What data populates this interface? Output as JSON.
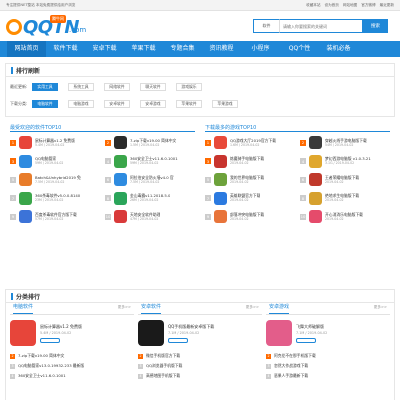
{
  "topbar": {
    "left": "专注提供NET整站 本站免费提供给用户浏览",
    "links": [
      "收藏本站",
      "设为首页",
      "网站地图",
      "官方微博",
      "最近更新"
    ]
  },
  "logo": {
    "main": "QQTN",
    "suffix": ".com",
    "badge": "腾牛网"
  },
  "search": {
    "select": "软件",
    "placeholder": "请输入你要搜索的关键词",
    "button": "搜索"
  },
  "nav": [
    "网站首页",
    "软件下载",
    "安卓下载",
    "苹果下载",
    "专题合集",
    "资讯教程",
    "小程序",
    "QQ个性",
    "装机必备"
  ],
  "ranking": {
    "title": "排行刷新",
    "filters": [
      {
        "label": "最近更新:",
        "chips": [
          "实用工具",
          "系统工具",
          "网络软件",
          "聊天软件",
          "游戏娱乐"
        ]
      },
      {
        "label": "下载分类:",
        "chips": [
          "电脑软件",
          "电脑游戏",
          "安卓软件",
          "安卓游戏",
          "苹果软件",
          "苹果游戏"
        ]
      }
    ]
  },
  "soft_panel": {
    "title": "最受欢迎的软件TOP10",
    "items": [
      {
        "name": "鼠标计算器v1.2 免费版",
        "meta": "5.4M / 2019-04-02",
        "color": "#e7453a"
      },
      {
        "name": "7-zip下载v19.00 简体中文",
        "meta": "1.5M / 2019-04-02",
        "color": "#2b2b2b"
      },
      {
        "name": "QQ电脑管家",
        "meta": "59M / 2019-04-02",
        "color": "#2e8be0"
      },
      {
        "name": "360安全卫士v11.6.0.1001",
        "meta": "59M / 2019-04-02",
        "color": "#3aa64a"
      },
      {
        "name": "Batch&Unhybrid2019 免",
        "meta": "7.5M / 2019-04-02",
        "color": "#e87c2a"
      },
      {
        "name": "阿拉伯安全防火墙v4.0 官",
        "meta": "7.5M / 2019-04-02",
        "color": "#2e8be0"
      },
      {
        "name": "360杀毒软件v5.0.0.8140",
        "meta": "23M / 2019-04-02",
        "color": "#3aa64a"
      },
      {
        "name": "金山毒霸v11.2018.5.0 ",
        "meta": "26M / 2019-04-02",
        "color": "#2aa55a"
      },
      {
        "name": "百度杀毒软件官方版下载",
        "meta": "57M / 2019-04-02",
        "color": "#3c73d8"
      },
      {
        "name": "天地安全软件助理",
        "meta": "47M / 2019-04-02",
        "color": "#d93a3a"
      }
    ]
  },
  "game_panel": {
    "title": "下载最多的游戏TOP10",
    "items": [
      {
        "name": "QQ游戏大厅2019官方下载",
        "meta": "1.6M / 2019-04-02",
        "color": "#e84a3a"
      },
      {
        "name": "穿越火线手游电脑版下载",
        "meta": "54M / 2019-04-02",
        "color": "#3a3a3a"
      },
      {
        "name": "炼魔骑手电脑版下载",
        "meta": "2019-04-02",
        "color": "#c8342e"
      },
      {
        "name": "梦幻西游电脑版 v1.0.3.21",
        "meta": "3.1G / 2019-04-02",
        "color": "#e0a72d"
      },
      {
        "name": "我的世界电脑版下载",
        "meta": "2019-04-02",
        "color": "#6da23b"
      },
      {
        "name": "王者荣耀电脑版下载",
        "meta": "2019-04-02",
        "color": "#c0392b"
      },
      {
        "name": "英雄联盟官方下载",
        "meta": "2019-04-02",
        "color": "#2b7ae0"
      },
      {
        "name": "绝地求生电脑版下载",
        "meta": "2019-04-02",
        "color": "#d6a12f"
      },
      {
        "name": "部落冲突电脑版下载",
        "meta": "2019-04-02",
        "color": "#e8743a"
      },
      {
        "name": "开心消消乐电脑版下载",
        "meta": "2019-04-02",
        "color": "#e54b6b"
      }
    ]
  },
  "category": {
    "title": "分类排行",
    "more": "更多>>",
    "columns": [
      {
        "title": "电脑软件",
        "feat": {
          "name": "鼠标计算器v1.2 免费版",
          "meta": "5.4M / 2019-04-02",
          "color": "#e7453a"
        },
        "list": [
          "7-zip下载v19.00 简体中文",
          "QQ电脑管家v13.0.19932.233 最新版",
          "360安全卫士v11.6.0.1001"
        ]
      },
      {
        "title": "安卓软件",
        "feat": {
          "name": "QQ手机版最新安卓版下载",
          "meta": "7.1M / 2019-04-02",
          "color": "#1a1a1a"
        },
        "list": [
          "微信手机版官方下载",
          "QQ浏览器手机版下载",
          "高德地图手机版下载"
        ]
      },
      {
        "title": "安卓游戏",
        "feat": {
          "name": "飞舞大师破解版",
          "meta": "7.1M / 2019-04-02",
          "color": "#e35d8a"
        },
        "list": [
          "阿克伦不在那手机版下载",
          "忽然大作战游戏下载",
          "恶果人手游最新下载"
        ]
      }
    ]
  }
}
